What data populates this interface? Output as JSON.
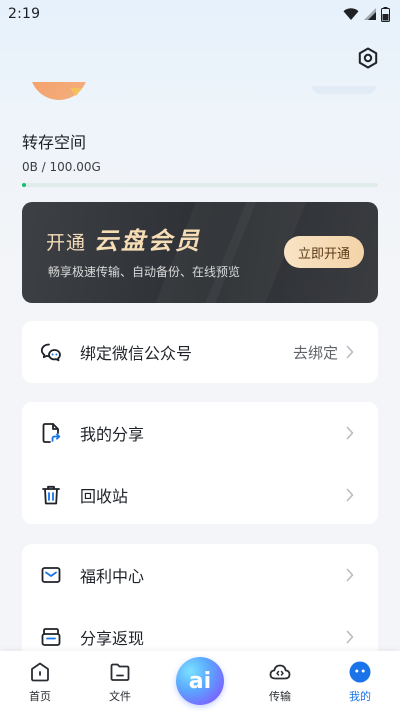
{
  "status_bar": {
    "time": "2:19"
  },
  "storage": {
    "title": "转存空间",
    "usage_text": "0B / 100.00G",
    "progress_fraction": 0.0
  },
  "vip_banner": {
    "prefix": "开通",
    "brand": "云盘会员",
    "subtitle": "畅享极速传输、自动备份、在线预览",
    "button_label": "立即开通"
  },
  "wechat_card": {
    "label": "绑定微信公众号",
    "action": "去绑定"
  },
  "files_card": {
    "items": [
      {
        "label": "我的分享",
        "icon": "share-file-icon"
      },
      {
        "label": "回收站",
        "icon": "trash-icon"
      }
    ]
  },
  "benefits_card": {
    "items": [
      {
        "label": "福利中心",
        "icon": "envelope-icon"
      },
      {
        "label": "分享返现",
        "icon": "wallet-icon"
      }
    ]
  },
  "tab_bar": {
    "items": [
      {
        "label": "首页",
        "icon": "home-icon"
      },
      {
        "label": "文件",
        "icon": "folder-icon"
      },
      {
        "label": "AI",
        "icon": "ai-icon"
      },
      {
        "label": "传输",
        "icon": "transfer-cloud-icon"
      },
      {
        "label": "我的",
        "icon": "profile-icon"
      }
    ],
    "active_index": 4,
    "ai_label": "ai"
  },
  "colors": {
    "accent": "#1a73e8",
    "progress": "#13c16b",
    "vip_gold": "#f6ddb6"
  }
}
